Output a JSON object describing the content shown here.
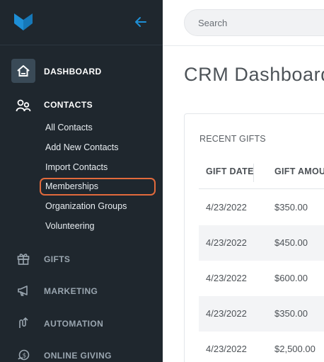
{
  "sidebar": {
    "nav": {
      "dashboard": "DASHBOARD",
      "contacts": "CONTACTS",
      "gifts": "GIFTS",
      "marketing": "MARKETING",
      "automation": "AUTOMATION",
      "online_giving": "ONLINE GIVING"
    },
    "contacts_sub": [
      "All Contacts",
      "Add New Contacts",
      "Import Contacts",
      "Memberships",
      "Organization Groups",
      "Volunteering"
    ],
    "highlighted_item": "Memberships"
  },
  "colors": {
    "sidebar_bg": "#1f272e",
    "accent_blue": "#1e8fd6",
    "highlight_orange": "#e26a3c",
    "active_tile": "#3a4a57"
  },
  "search": {
    "placeholder": "Search"
  },
  "main": {
    "title": "CRM Dashboard",
    "recent_gifts": {
      "title": "RECENT GIFTS",
      "columns": [
        "GIFT DATE",
        "GIFT AMOU"
      ],
      "rows": [
        {
          "date": "4/23/2022",
          "amount": "$350.00"
        },
        {
          "date": "4/23/2022",
          "amount": "$450.00"
        },
        {
          "date": "4/23/2022",
          "amount": "$600.00"
        },
        {
          "date": "4/23/2022",
          "amount": "$350.00"
        },
        {
          "date": "4/23/2022",
          "amount": "$2,500.00"
        }
      ]
    }
  }
}
